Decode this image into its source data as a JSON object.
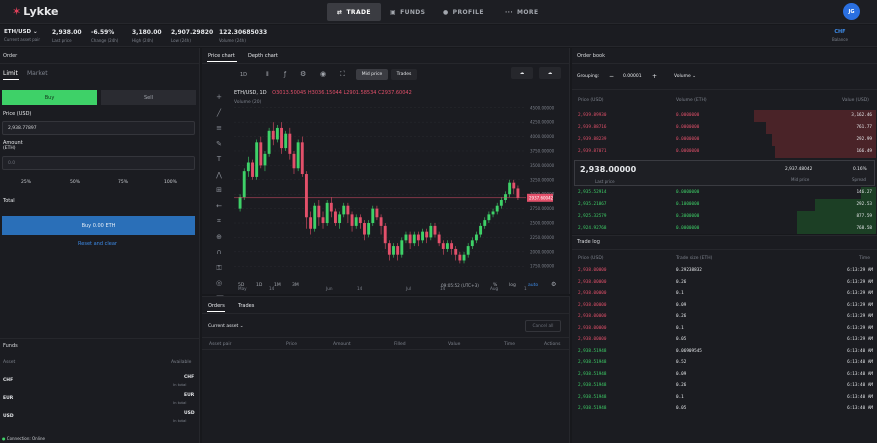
{
  "nav": {
    "brand": "Lykke",
    "trade": "TRADE",
    "funds": "FUNDS",
    "profile": "PROFILE",
    "more": "MORE",
    "avatar": "JG"
  },
  "stats": {
    "pair": "ETH/USD",
    "pair_label": "Current asset pair",
    "last_price": "2,938.00",
    "last_price_label": "Last price",
    "change": "-6.59%",
    "change_label": "Change (24h)",
    "high": "3,180.00",
    "high_label": "High (24h)",
    "low": "2,907.29820",
    "low_label": "Low (24h)",
    "volume": "122.30685033",
    "volume_label": "Volume (24h)",
    "balance_value": "CHF",
    "balance_label": "Balance"
  },
  "order": {
    "title": "Order",
    "tab_limit": "Limit",
    "tab_market": "Market",
    "buy": "Buy",
    "sell": "Sell",
    "price_label": "Price (USD)",
    "price_value": "2,938.77897",
    "amount_label": "Amount",
    "amount_unit": "(ETH)",
    "amount_placeholder": "0.0",
    "pcts": [
      "25%",
      "50%",
      "75%",
      "100%"
    ],
    "total_label": "Total",
    "submit": "Buy 0.00 ETH",
    "reset": "Reset and clear"
  },
  "funds": {
    "title": "Funds",
    "col_asset": "Asset",
    "col_available": "Available",
    "rows": [
      {
        "asset": "CHF",
        "amount": "CHF",
        "in_total": "In total"
      },
      {
        "asset": "EUR",
        "amount": "EUR",
        "in_total": "In total"
      },
      {
        "asset": "USD",
        "amount": "USD",
        "in_total": "In total"
      }
    ],
    "connection": "Connection: Online"
  },
  "chart_tabs": {
    "price": "Price chart",
    "depth": "Depth chart"
  },
  "chart_toolbar": {
    "interval": "1D",
    "mid_price": "Mid price",
    "trades": "Trades"
  },
  "chart_legend": {
    "symbol": "ETH/USD, 1D",
    "ohlc": "O3013.50045 H3036.15044 L2901.58534 C2937.60042",
    "volume": "Volume (20)"
  },
  "chart_data": {
    "type": "candlestick",
    "x_tick_labels": [
      "May",
      "14",
      "Jun",
      "14",
      "Jul",
      "14",
      "Aug",
      "1"
    ],
    "y_tick_labels": [
      "4500.00000",
      "4250.00000",
      "4000.00000",
      "3750.00000",
      "3500.00000",
      "3250.00000",
      "3000.00000",
      "2750.00000",
      "2500.00000",
      "2250.00000",
      "2000.00000",
      "1750.00000"
    ],
    "ylim": [
      1650,
      4600
    ],
    "current_price": "2937.60042",
    "candles": [
      [
        2750,
        2950,
        2700,
        3000
      ],
      [
        2950,
        3400,
        2900,
        3450
      ],
      [
        3400,
        3550,
        3300,
        3650
      ],
      [
        3550,
        3300,
        3250,
        3600
      ],
      [
        3300,
        3900,
        3250,
        3950
      ],
      [
        3900,
        3500,
        3450,
        4000
      ],
      [
        3500,
        3700,
        3400,
        3750
      ],
      [
        3700,
        4100,
        3650,
        4150
      ],
      [
        4100,
        3950,
        3850,
        4250
      ],
      [
        3950,
        4150,
        3900,
        4200
      ],
      [
        4150,
        3800,
        3700,
        4250
      ],
      [
        3800,
        4050,
        3750,
        4100
      ],
      [
        4050,
        3700,
        3600,
        4150
      ],
      [
        3700,
        3450,
        3350,
        3750
      ],
      [
        3450,
        3900,
        3400,
        3950
      ],
      [
        3900,
        3350,
        3300,
        4000
      ],
      [
        3350,
        2600,
        2400,
        3400
      ],
      [
        2600,
        2400,
        2300,
        2700
      ],
      [
        2400,
        2800,
        2350,
        2850
      ],
      [
        2800,
        2600,
        2450,
        2900
      ],
      [
        2600,
        2500,
        2400,
        2700
      ],
      [
        2500,
        2850,
        2450,
        2900
      ],
      [
        2850,
        2700,
        2600,
        2950
      ],
      [
        2700,
        2500,
        2450,
        2750
      ],
      [
        2500,
        2650,
        2400,
        2700
      ],
      [
        2650,
        2800,
        2600,
        2850
      ],
      [
        2800,
        2650,
        2500,
        2850
      ],
      [
        2650,
        2450,
        2350,
        2700
      ],
      [
        2450,
        2600,
        2400,
        2650
      ],
      [
        2600,
        2500,
        2400,
        2650
      ],
      [
        2500,
        2300,
        2200,
        2550
      ],
      [
        2300,
        2500,
        2250,
        2550
      ],
      [
        2500,
        2750,
        2450,
        2800
      ],
      [
        2750,
        2600,
        2550,
        2800
      ],
      [
        2600,
        2450,
        2300,
        2650
      ],
      [
        2450,
        2150,
        2050,
        2500
      ],
      [
        2150,
        1950,
        1850,
        2200
      ],
      [
        1950,
        2100,
        1900,
        2150
      ],
      [
        2100,
        1950,
        1850,
        2150
      ],
      [
        1950,
        2200,
        1900,
        2250
      ],
      [
        2200,
        2300,
        2150,
        2350
      ],
      [
        2300,
        2150,
        2050,
        2350
      ],
      [
        2150,
        2300,
        2100,
        2350
      ],
      [
        2300,
        2200,
        2100,
        2350
      ],
      [
        2200,
        2350,
        2150,
        2400
      ],
      [
        2350,
        2250,
        2150,
        2400
      ],
      [
        2250,
        2450,
        2200,
        2500
      ],
      [
        2450,
        2300,
        2250,
        2500
      ],
      [
        2300,
        2150,
        2100,
        2350
      ],
      [
        2150,
        2050,
        1950,
        2200
      ],
      [
        2050,
        2150,
        2000,
        2200
      ],
      [
        2150,
        2050,
        1950,
        2200
      ],
      [
        2050,
        1950,
        1850,
        2100
      ],
      [
        1950,
        1850,
        1800,
        2000
      ],
      [
        1850,
        1950,
        1800,
        2000
      ],
      [
        1950,
        2100,
        1900,
        2150
      ],
      [
        2100,
        2200,
        2050,
        2250
      ],
      [
        2200,
        2300,
        2150,
        2350
      ],
      [
        2300,
        2450,
        2250,
        2500
      ],
      [
        2450,
        2550,
        2400,
        2600
      ],
      [
        2550,
        2650,
        2500,
        2700
      ],
      [
        2650,
        2700,
        2600,
        2750
      ],
      [
        2700,
        2800,
        2650,
        2850
      ],
      [
        2800,
        2900,
        2750,
        2950
      ],
      [
        2900,
        3000,
        2850,
        3050
      ],
      [
        3000,
        3200,
        2950,
        3250
      ],
      [
        3200,
        3100,
        3000,
        3250
      ],
      [
        3100,
        2940,
        2900,
        3150
      ]
    ]
  },
  "chart_footer": {
    "ranges": [
      "5D",
      "1D",
      "1M",
      "3M"
    ],
    "time": "09:05:52 (UTC+3)",
    "pct": "%",
    "log": "log",
    "auto": "auto"
  },
  "orders": {
    "tab_orders": "Orders",
    "tab_trades": "Trades",
    "filter": "Current asset",
    "cancel_all": "Cancel all",
    "cols": [
      "Asset pair",
      "Price",
      "Amount",
      "Filled",
      "Value",
      "Time",
      "Actions"
    ]
  },
  "orderbook": {
    "title": "Order book",
    "grouping_label": "Grouping:",
    "grouping_value": "0.00001",
    "volume_select": "Volume",
    "col_price": "Price (USD)",
    "col_vol": "Volume (ETH)",
    "col_value": "Value (USD)",
    "asks": [
      {
        "price": "2,939.89930",
        "vol": "0.0000000",
        "value": "3,162.46",
        "depth": 0.4
      },
      {
        "price": "2,939.88716",
        "vol": "0.0000000",
        "value": "761.77",
        "depth": 0.36
      },
      {
        "price": "2,939.88239",
        "vol": "0.0000000",
        "value": "292.99",
        "depth": 0.34
      },
      {
        "price": "2,939.87071",
        "vol": "0.0000000",
        "value": "166.49",
        "depth": 0.33
      }
    ],
    "mid_price": "2,938.00000",
    "mid_label_last": "Last price",
    "mid_value": "2,937.48042",
    "mid_value_label": "Mid price",
    "spread": "0.16%",
    "spread_label": "Spread",
    "bids": [
      {
        "price": "2,935.52914",
        "vol": "0.0000000",
        "value": "146.27",
        "depth": 0.05
      },
      {
        "price": "2,935.21867",
        "vol": "0.1000000",
        "value": "292.53",
        "depth": 0.2
      },
      {
        "price": "2,925.32579",
        "vol": "0.3000000",
        "value": "877.59",
        "depth": 0.26
      },
      {
        "price": "2,924.92768",
        "vol": "0.0000000",
        "value": "768.58",
        "depth": 0.26
      }
    ]
  },
  "tradelog": {
    "title": "Trade log",
    "col_price": "Price (USD)",
    "col_size": "Trade size (ETH)",
    "col_time": "Time",
    "rows": [
      {
        "price": "2,938.00000",
        "size": "0.29238832",
        "time": "6:13:29 AM",
        "side": "sell"
      },
      {
        "price": "2,938.00000",
        "size": "0.26",
        "time": "6:13:29 AM",
        "side": "sell"
      },
      {
        "price": "2,938.00000",
        "size": "0.1",
        "time": "6:13:29 AM",
        "side": "sell"
      },
      {
        "price": "2,938.00000",
        "size": "0.09",
        "time": "6:13:29 AM",
        "side": "sell"
      },
      {
        "price": "2,938.00000",
        "size": "0.26",
        "time": "6:13:29 AM",
        "side": "sell"
      },
      {
        "price": "2,938.00000",
        "size": "0.1",
        "time": "6:13:29 AM",
        "side": "sell"
      },
      {
        "price": "2,938.00000",
        "size": "0.05",
        "time": "6:13:29 AM",
        "side": "sell"
      },
      {
        "price": "2,938.51948",
        "size": "0.06909545",
        "time": "6:13:40 AM",
        "side": "buy"
      },
      {
        "price": "2,938.51948",
        "size": "0.52",
        "time": "6:13:40 AM",
        "side": "buy"
      },
      {
        "price": "2,938.51948",
        "size": "0.09",
        "time": "6:13:40 AM",
        "side": "buy"
      },
      {
        "price": "2,938.51948",
        "size": "0.26",
        "time": "6:13:40 AM",
        "side": "buy"
      },
      {
        "price": "2,938.51948",
        "size": "0.1",
        "time": "6:13:40 AM",
        "side": "buy"
      },
      {
        "price": "2,938.51948",
        "size": "0.05",
        "time": "6:13:40 AM",
        "side": "buy"
      }
    ]
  },
  "colors": {
    "up": "#3ed168",
    "down": "#e2506a",
    "accent": "#2a6fe0",
    "bg": "#17181c"
  }
}
